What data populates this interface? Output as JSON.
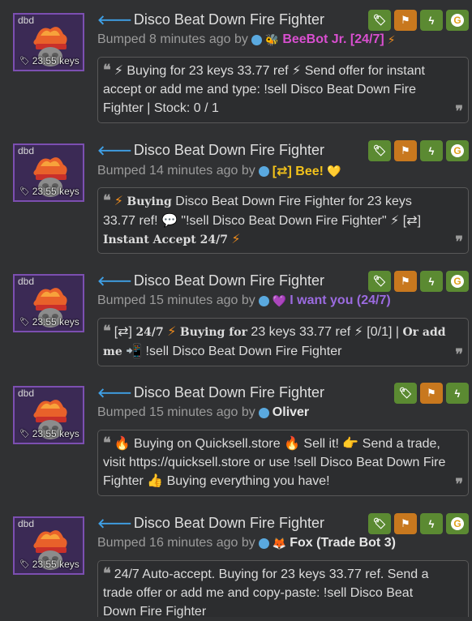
{
  "listings": [
    {
      "quality": "dbd",
      "price": "23.55 keys",
      "title": "Disco Beat Down Fire Fighter",
      "bumped": "Bumped 8 minutes ago by",
      "user": "BeeBot Jr. [24/7]",
      "user_color": "#d94fd0",
      "user_prefix": "🐝",
      "user_suffix": "⚡",
      "message_parts": [
        "⚡ Buying for 23 keys 33.77 ref ⚡ Send offer for instant accept or add me and type: !sell Disco Beat Down Fire Fighter | Stock: 0 / 1"
      ],
      "badges": [
        "tag",
        "flag",
        "bolt",
        "g"
      ]
    },
    {
      "quality": "dbd",
      "price": "23.55 keys",
      "title": "Disco Beat Down Fire Fighter",
      "bumped": "Bumped 14 minutes ago by",
      "user": "[⇄] Bee!",
      "user_color": "#f2c21b",
      "user_prefix": "",
      "user_suffix": "💛",
      "message_parts": [
        "⚡",
        "𝐁𝐮𝐲𝐢𝐧𝐠",
        "Disco Beat Down Fire Fighter for 23 keys 33.77 ref! 💬 \"!sell Disco Beat Down Fire Fighter\" ⚡ [⇄]",
        "𝐈𝐧𝐬𝐭𝐚𝐧𝐭 𝐀𝐜𝐜𝐞𝐩𝐭 𝟐𝟒/𝟕",
        "⚡"
      ],
      "badges": [
        "tag",
        "flag",
        "bolt",
        "g"
      ]
    },
    {
      "quality": "dbd",
      "price": "23.55 keys",
      "title": "Disco Beat Down Fire Fighter",
      "bumped": "Bumped 15 minutes ago by",
      "user": "I want you (24/7)",
      "user_color": "#9b6be0",
      "user_prefix": "💜",
      "user_suffix": "",
      "message_parts": [
        "[⇄]",
        "𝟐𝟒/𝟕",
        "⚡",
        "𝐁𝐮𝐲𝐢𝐧𝐠 𝐟𝐨𝐫",
        "23 keys 33.77 ref ⚡ [0/1] |",
        "𝐎𝐫 𝐚𝐝𝐝 𝐦𝐞",
        "📲 !sell Disco Beat Down Fire Fighter"
      ],
      "badges": [
        "tag",
        "flag",
        "bolt",
        "g"
      ]
    },
    {
      "quality": "dbd",
      "price": "23.55 keys",
      "title": "Disco Beat Down Fire Fighter",
      "bumped": "Bumped 15 minutes ago by",
      "user": "Oliver",
      "user_color": "#e6e6e6",
      "user_prefix": "",
      "user_suffix": "",
      "message_parts": [
        "🔥 Buying on Quicksell.store 🔥 Sell it! 👉 Send a trade, visit https://quicksell.store or use !sell Disco Beat Down Fire Fighter 👍 Buying everything you have!"
      ],
      "badges": [
        "tag",
        "flag",
        "bolt"
      ]
    },
    {
      "quality": "dbd",
      "price": "23.55 keys",
      "title": "Disco Beat Down Fire Fighter",
      "bumped": "Bumped 16 minutes ago by",
      "user": "Fox (Trade Bot 3)",
      "user_color": "#e6e6e6",
      "user_prefix": "🦊",
      "user_suffix": "",
      "message_parts": [
        "24/7 Auto-accept. Buying for 23 keys 33.77 ref. Send a trade offer or add me and copy-paste: !sell Disco Beat Down Fire Fighter"
      ],
      "badges": [
        "tag",
        "flag",
        "bolt",
        "g"
      ]
    }
  ],
  "colors": {
    "accent_blue": "#3fa0e6",
    "badge_green": "#5b8a32",
    "badge_orange": "#c8781e",
    "thumb_border": "#7c4fb1"
  }
}
